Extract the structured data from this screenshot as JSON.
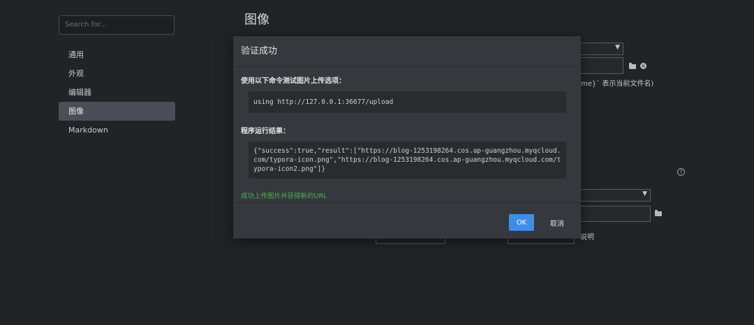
{
  "sidebar": {
    "search_placeholder": "Search for...",
    "items": [
      {
        "label": "通用"
      },
      {
        "label": "外观"
      },
      {
        "label": "编辑器"
      },
      {
        "label": "图像",
        "active": true
      },
      {
        "label": "Markdown"
      }
    ]
  },
  "page": {
    "title": "图像",
    "bg_hint": "me}` 表示当前文件名)",
    "bg_partial_label": "说明"
  },
  "modal": {
    "title": "验证成功",
    "command_label": "使用以下命令测试图片上传选项：",
    "command": "using http://127.0.0.1:36677/upload",
    "result_label": "程序运行结果：",
    "result": "{\"success\":true,\"result\":[\"https://blog-1253198264.cos.ap-guangzhou.myqcloud.com/typora-icon.png\",\"https://blog-1253198264.cos.ap-guangzhou.myqcloud.com/typora-icon2.png\"]}",
    "success_message": "成功上传图片并获得新的URL",
    "ok_label": "OK",
    "cancel_label": "取消"
  },
  "colors": {
    "accent": "#3d8ee8",
    "success": "#4caf50"
  }
}
